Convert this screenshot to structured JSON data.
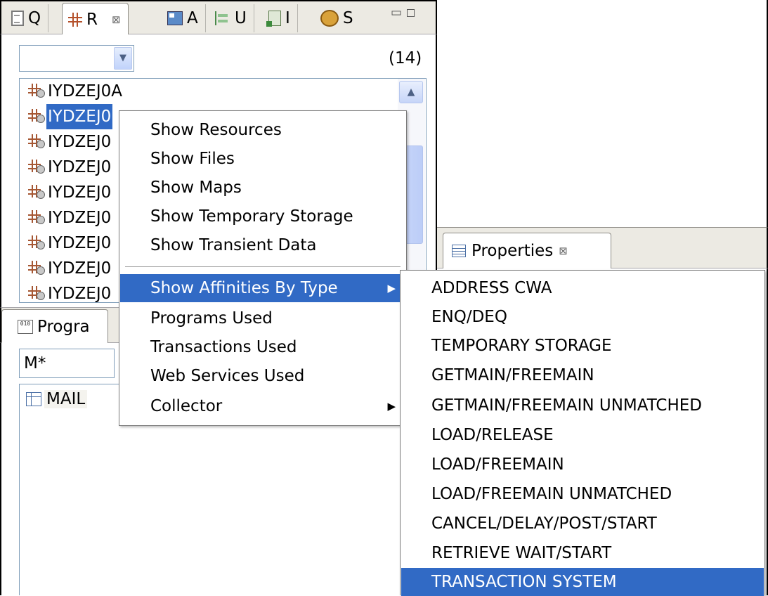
{
  "tabs": [
    {
      "label": "Q",
      "icon": "document-icon"
    },
    {
      "label": "R",
      "icon": "resource-grid-icon",
      "active": true,
      "close": "⊠"
    },
    {
      "label": "A",
      "icon": "application-icon"
    },
    {
      "label": "U",
      "icon": "tree-icon"
    },
    {
      "label": "I",
      "icon": "import-file-icon"
    },
    {
      "label": "S",
      "icon": "gear-icon"
    }
  ],
  "view_controls": "▭ ◻",
  "resources_view": {
    "combo_value": "",
    "count": "(14)",
    "items": [
      {
        "label": "IYDZEJ0A"
      },
      {
        "label": "IYDZEJ0",
        "selected": true
      },
      {
        "label": "IYDZEJ0"
      },
      {
        "label": "IYDZEJ0"
      },
      {
        "label": "IYDZEJ0"
      },
      {
        "label": "IYDZEJ0"
      },
      {
        "label": "IYDZEJ0"
      },
      {
        "label": "IYDZEJ0"
      },
      {
        "label": "IYDZEJ0"
      }
    ]
  },
  "programs_view": {
    "tab_label": "Progra",
    "filter_value": "M*",
    "items": [
      {
        "label": "MAIL"
      }
    ]
  },
  "properties_view": {
    "tab_label": "Properties",
    "close": "⊠"
  },
  "context_menu": {
    "items": [
      "Show Resources",
      "Show Files",
      "Show Maps",
      "Show Temporary Storage",
      "Show Transient Data",
      "Show Affinities By Type",
      "Programs Used",
      "Transactions Used",
      "Web Services Used",
      "Collector"
    ],
    "highlighted": "Show Affinities By Type"
  },
  "submenu": {
    "items": [
      "ADDRESS CWA",
      "ENQ/DEQ",
      "TEMPORARY STORAGE",
      "GETMAIN/FREEMAIN",
      "GETMAIN/FREEMAIN UNMATCHED",
      "LOAD/RELEASE",
      "LOAD/FREEMAIN",
      "LOAD/FREEMAIN UNMATCHED",
      "CANCEL/DELAY/POST/START",
      "RETRIEVE WAIT/START",
      "TRANSACTION SYSTEM"
    ],
    "highlighted": "TRANSACTION SYSTEM"
  },
  "colors": {
    "selection": "#316ac5",
    "tab_background": "#eceae3",
    "border": "#7f9db9"
  }
}
